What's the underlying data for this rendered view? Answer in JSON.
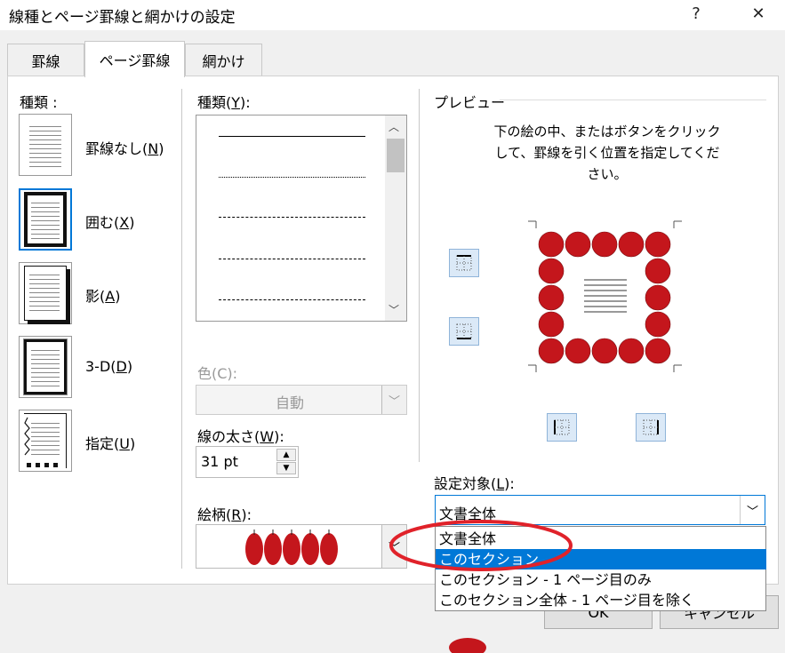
{
  "window": {
    "title": "線種とページ罫線と網かけの設定",
    "help_label": "?",
    "close_label": "✕"
  },
  "tabs": [
    {
      "label": "罫線"
    },
    {
      "label": "ページ罫線"
    },
    {
      "label": "網かけ"
    }
  ],
  "settings": {
    "header": "種類 :",
    "items": [
      {
        "prefix": "罫線なし(",
        "key": "N",
        "suffix": ")"
      },
      {
        "prefix": "囲む(",
        "key": "X",
        "suffix": ")"
      },
      {
        "prefix": "影(",
        "key": "A",
        "suffix": ")"
      },
      {
        "prefix": "3-D(",
        "key": "D",
        "suffix": ")"
      },
      {
        "prefix": "指定(",
        "key": "U",
        "suffix": ")"
      }
    ]
  },
  "style": {
    "label_prefix": "種類(",
    "label_key": "Y",
    "label_suffix": "):"
  },
  "color": {
    "label": "色(C):",
    "value": "自動"
  },
  "width": {
    "label_prefix": "線の太さ(",
    "label_key": "W",
    "label_suffix": "):",
    "value": "31 pt"
  },
  "art": {
    "label_prefix": "絵柄(",
    "label_key": "R",
    "label_suffix": "):"
  },
  "preview": {
    "header": "プレビュー",
    "instruction": "下の絵の中、またはボタンをクリックして、罫線を引く位置を指定してください。"
  },
  "apply_to": {
    "label_prefix": "設定対象(",
    "label_key": "L",
    "label_suffix": "):",
    "value": "文書全体",
    "options": [
      {
        "label": "文書全体"
      },
      {
        "label": "このセクション"
      },
      {
        "label": "このセクション - 1 ページ目のみ"
      },
      {
        "label": "このセクション全体 - 1 ページ目を除く"
      }
    ],
    "selected_option_index": 1
  },
  "buttons": {
    "ok": "OK",
    "cancel": "キャンセル"
  },
  "colors": {
    "accent": "#0078d7",
    "highlight": "#e0222a",
    "apple": "#c4161c"
  }
}
